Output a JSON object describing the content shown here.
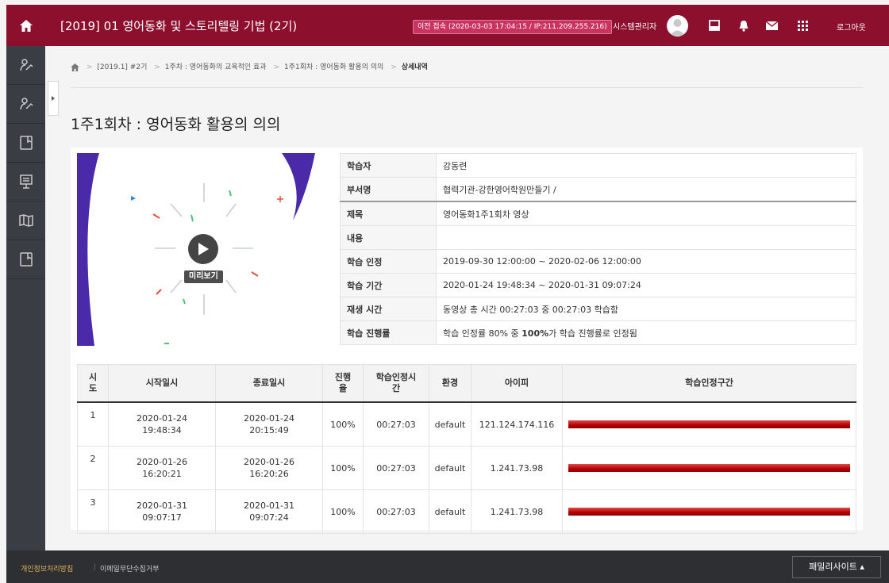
{
  "header": {
    "course_title": "[2019] 01 영어동화 및 스토리텔링 기법 (2기)",
    "last_login": "이전 접속 (2020-03-03 17:04:15 / IP:211.209.255.216)",
    "username": "시스템관리자",
    "logout_label": "로그아웃",
    "colors": {
      "brand": "#8d0f2e",
      "badge": "#c8345f"
    }
  },
  "breadcrumb": [
    "[2019.1] #2기",
    "1주차 : 영어동화의 교육적인 효과",
    "1주1회차 : 영어동화 활용의 의의",
    "상세내역"
  ],
  "page": {
    "title": "1주1회차 : 영어동화 활용의 의의"
  },
  "video": {
    "preview_label": "미리보기"
  },
  "info": [
    {
      "label": "학습자",
      "value": "강동련"
    },
    {
      "label": "부서명",
      "value": "협력기관-강한영어학원만들기 /"
    },
    {
      "label": "제목",
      "value": "영어동화1주1회차 영상"
    },
    {
      "label": "내용",
      "value": ""
    },
    {
      "label": "학습 인정",
      "value": "2019-09-30 12:00:00 ~ 2020-02-06 12:00:00"
    },
    {
      "label": "학습 기간",
      "value": "2020-01-24 19:48:34 ~ 2020-01-31 09:07:24"
    },
    {
      "label": "재생 시간",
      "value": "동영상 총 시간 00:27:03 중 00:27:03 학습함"
    },
    {
      "label": "학습 진행률",
      "value_pre": "학습 인정률 80% 중 ",
      "value_bold": "100%",
      "value_post": "가 학습 진행률로 인정됨"
    }
  ],
  "log": {
    "headers": [
      "시\n도",
      "시작일시",
      "종료일시",
      "진행\n율",
      "학습인정시\n간",
      "환경",
      "아이피",
      "학습인정구간"
    ],
    "rows": [
      {
        "no": "1",
        "start": "2020-01-24\n19:48:34",
        "end": "2020-01-24\n20:15:49",
        "rate": "100%",
        "time": "00:27:03",
        "env": "default",
        "ip": "121.124.174.116",
        "coverage": 1.0
      },
      {
        "no": "2",
        "start": "2020-01-26\n16:20:21",
        "end": "2020-01-26\n16:20:26",
        "rate": "100%",
        "time": "00:27:03",
        "env": "default",
        "ip": "1.241.73.98",
        "coverage": 1.0
      },
      {
        "no": "3",
        "start": "2020-01-31\n09:07:17",
        "end": "2020-01-31\n09:07:24",
        "rate": "100%",
        "time": "00:27:03",
        "env": "default",
        "ip": "1.241.73.98",
        "coverage": 1.0
      }
    ]
  },
  "footer": {
    "privacy": "개인정보처리방침",
    "divider": "|",
    "email_refuse": "이메일무단수집거부",
    "family_site": "패밀리사이트 ▴"
  }
}
